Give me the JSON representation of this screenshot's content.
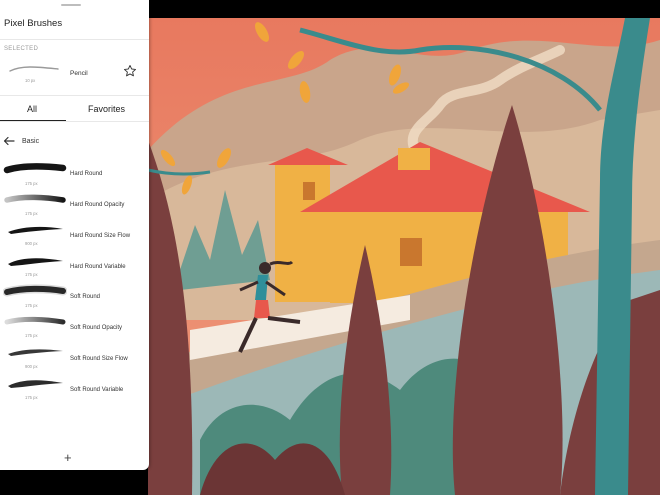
{
  "panel": {
    "title": "Pixel Brushes",
    "selected_label": "SELECTED",
    "selected_brush": {
      "name": "Pencil",
      "size": "10 px"
    },
    "tabs": [
      {
        "label": "All",
        "active": true
      },
      {
        "label": "Favorites",
        "active": false
      }
    ],
    "section": "Basic",
    "brushes": [
      {
        "name": "Hard Round",
        "size": "175 px"
      },
      {
        "name": "Hard Round Opacity",
        "size": "175 px"
      },
      {
        "name": "Hard Round Size Flow",
        "size": "900 px"
      },
      {
        "name": "Hard Round Variable",
        "size": "175 px"
      },
      {
        "name": "Soft Round",
        "size": "175 px"
      },
      {
        "name": "Soft Round Opacity",
        "size": "175 px"
      },
      {
        "name": "Soft Round Size Flow",
        "size": "900 px"
      },
      {
        "name": "Soft Round Variable",
        "size": "175 px"
      }
    ],
    "add_icon": "+"
  },
  "icons": {
    "star": "star-icon",
    "back": "arrow-left-icon",
    "add": "plus-icon"
  },
  "colors": {
    "accent": "#222222",
    "sky": "#e47a5e",
    "roof": "#e8584c",
    "wall": "#f0b145",
    "tree": "#7a3f3e",
    "trunk": "#3a8b8c"
  }
}
